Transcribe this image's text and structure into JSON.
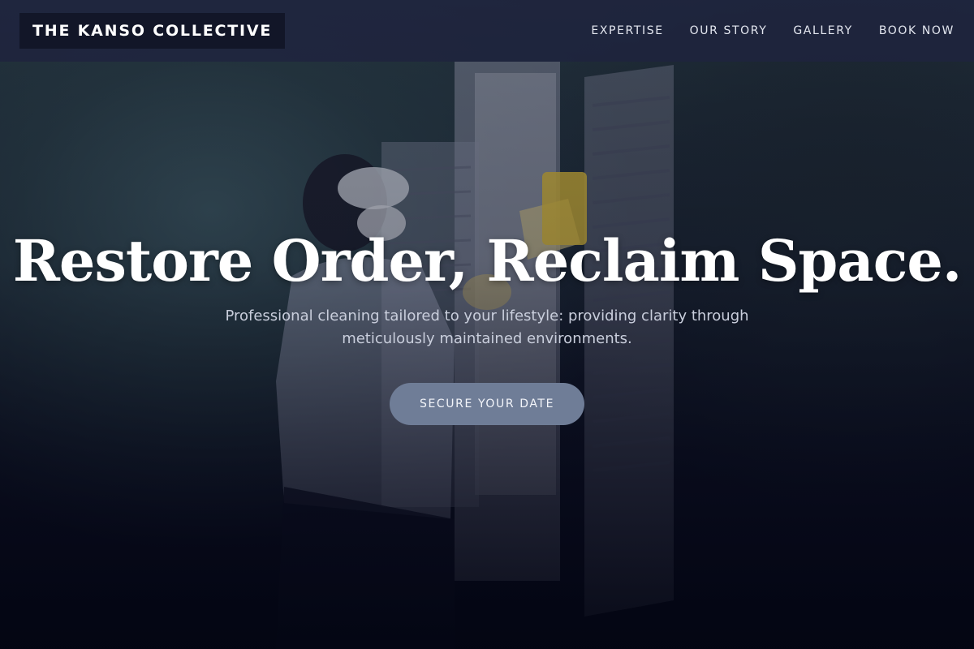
{
  "header": {
    "brand": "THE KANSO COLLECTIVE",
    "nav": [
      {
        "label": "EXPERTISE"
      },
      {
        "label": "OUR STORY"
      },
      {
        "label": "GALLERY"
      },
      {
        "label": "BOOK NOW"
      }
    ]
  },
  "hero": {
    "headline": "Restore Order, Reclaim Space.",
    "subtext": "Professional cleaning tailored to your lifestyle: providing clarity through meticulously maintained environments.",
    "cta_label": "SECURE YOUR DATE",
    "image_subject": "person in protective goggles, mask and yellow gloves cleaning white window shutters with a sponge"
  },
  "colors": {
    "header_bg": "#1e233e",
    "brand_bg": "#121628",
    "cta_bg": "#6f7d97",
    "text_light": "#ffffff",
    "subtext": "#c9cedc"
  }
}
